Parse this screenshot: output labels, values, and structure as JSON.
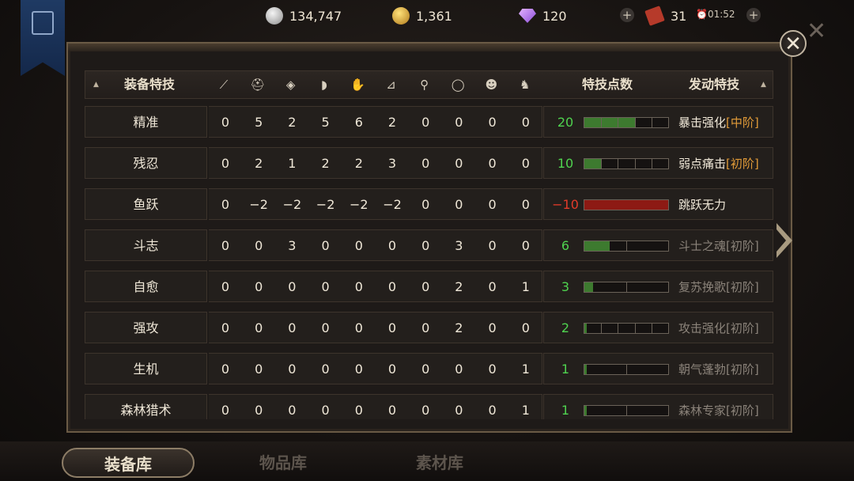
{
  "resources": {
    "silver": "134,747",
    "gold": "1,361",
    "gems": "120",
    "tickets": "31",
    "timer": "01:52"
  },
  "header": {
    "col_name": "装备特技",
    "col_points": "特技点数",
    "col_skill": "发动特技",
    "slot_icons": [
      "sword-icon",
      "helmet-icon",
      "armor-icon",
      "shoulder-icon",
      "glove-icon",
      "boot-icon",
      "necklace-icon",
      "ring-icon",
      "mask-icon",
      "pet-icon"
    ]
  },
  "rows": [
    {
      "name": "精准",
      "values": [
        "0",
        "5",
        "2",
        "5",
        "6",
        "2",
        "0",
        "0",
        "0",
        "0"
      ],
      "points": "20",
      "points_color": "green",
      "fill": 0.6,
      "segments": 5,
      "skill": "暴击强化",
      "tier": "[中阶]",
      "active": true
    },
    {
      "name": "残忍",
      "values": [
        "0",
        "2",
        "1",
        "2",
        "2",
        "3",
        "0",
        "0",
        "0",
        "0"
      ],
      "points": "10",
      "points_color": "green",
      "fill": 0.2,
      "segments": 5,
      "skill": "弱点痛击",
      "tier": "[初阶]",
      "active": true
    },
    {
      "name": "鱼跃",
      "values": [
        "0",
        "−2",
        "−2",
        "−2",
        "−2",
        "−2",
        "0",
        "0",
        "0",
        "0"
      ],
      "points": "−10",
      "points_color": "red",
      "fill": 1.0,
      "segments": 1,
      "skill": "跳跃无力",
      "tier": "",
      "active": true,
      "negative": true
    },
    {
      "name": "斗志",
      "values": [
        "0",
        "0",
        "3",
        "0",
        "0",
        "0",
        "0",
        "3",
        "0",
        "0"
      ],
      "points": "6",
      "points_color": "green",
      "fill": 0.3,
      "segments": 2,
      "skill": "斗士之魂",
      "tier": "[初阶]",
      "active": false
    },
    {
      "name": "自愈",
      "values": [
        "0",
        "0",
        "0",
        "0",
        "0",
        "0",
        "0",
        "2",
        "0",
        "1"
      ],
      "points": "3",
      "points_color": "green",
      "fill": 0.1,
      "segments": 2,
      "skill": "复苏挽歌",
      "tier": "[初阶]",
      "active": false
    },
    {
      "name": "强攻",
      "values": [
        "0",
        "0",
        "0",
        "0",
        "0",
        "0",
        "0",
        "2",
        "0",
        "0"
      ],
      "points": "2",
      "points_color": "green",
      "fill": 0.03,
      "segments": 5,
      "skill": "攻击强化",
      "tier": "[初阶]",
      "active": false
    },
    {
      "name": "生机",
      "values": [
        "0",
        "0",
        "0",
        "0",
        "0",
        "0",
        "0",
        "0",
        "0",
        "1"
      ],
      "points": "1",
      "points_color": "green",
      "fill": 0.03,
      "segments": 2,
      "skill": "朝气蓬勃",
      "tier": "[初阶]",
      "active": false
    },
    {
      "name": "森林猎术",
      "values": [
        "0",
        "0",
        "0",
        "0",
        "0",
        "0",
        "0",
        "0",
        "0",
        "1"
      ],
      "points": "1",
      "points_color": "green",
      "fill": 0.03,
      "segments": 2,
      "skill": "森林专家",
      "tier": "[初阶]",
      "active": false
    }
  ],
  "tabs": [
    "装备库",
    "物品库",
    "素材库"
  ],
  "colors": {
    "green": "#4fd34f",
    "red": "#e23b2a",
    "accent": "#e09a38"
  }
}
